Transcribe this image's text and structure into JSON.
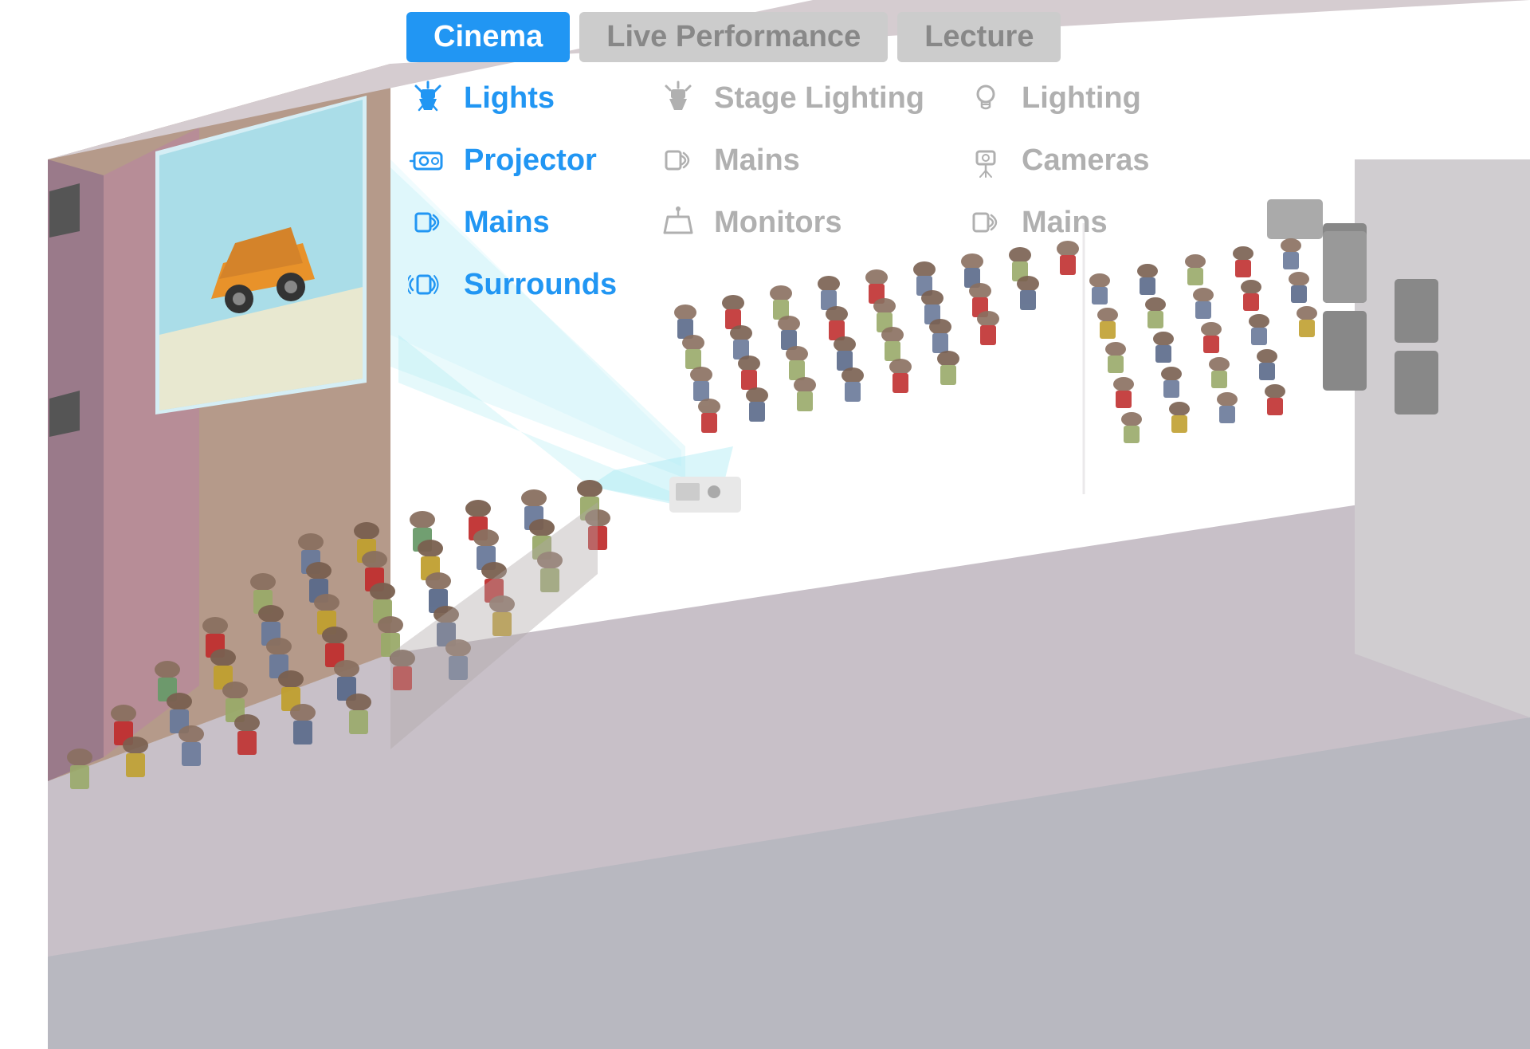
{
  "tabs": [
    {
      "id": "cinema",
      "label": "Cinema",
      "active": true
    },
    {
      "id": "live",
      "label": "Live Performance",
      "active": false
    },
    {
      "id": "lecture",
      "label": "Lecture",
      "active": false
    }
  ],
  "columns": [
    {
      "id": "cinema",
      "active": true,
      "items": [
        {
          "id": "lights",
          "label": "Lights",
          "icon": "spotlight"
        },
        {
          "id": "projector",
          "label": "Projector",
          "icon": "projector"
        },
        {
          "id": "mains",
          "label": "Mains",
          "icon": "speaker"
        },
        {
          "id": "surrounds",
          "label": "Surrounds",
          "icon": "surround"
        }
      ]
    },
    {
      "id": "live",
      "active": false,
      "items": [
        {
          "id": "stage-lighting",
          "label": "Stage Lighting",
          "icon": "stage-light"
        },
        {
          "id": "mains-live",
          "label": "Mains",
          "icon": "speaker"
        },
        {
          "id": "monitors",
          "label": "Monitors",
          "icon": "monitor"
        }
      ]
    },
    {
      "id": "lecture",
      "active": false,
      "items": [
        {
          "id": "lighting-lec",
          "label": "Lighting",
          "icon": "bulb"
        },
        {
          "id": "cameras",
          "label": "Cameras",
          "icon": "camera"
        },
        {
          "id": "mains-lec",
          "label": "Mains",
          "icon": "speaker"
        }
      ]
    }
  ],
  "colors": {
    "active_tab_bg": "#2196F3",
    "active_tab_text": "#ffffff",
    "inactive_tab_bg": "#cccccc",
    "inactive_tab_text": "#888888",
    "active_item": "#2196F3",
    "inactive_item": "#b0b0b0"
  }
}
